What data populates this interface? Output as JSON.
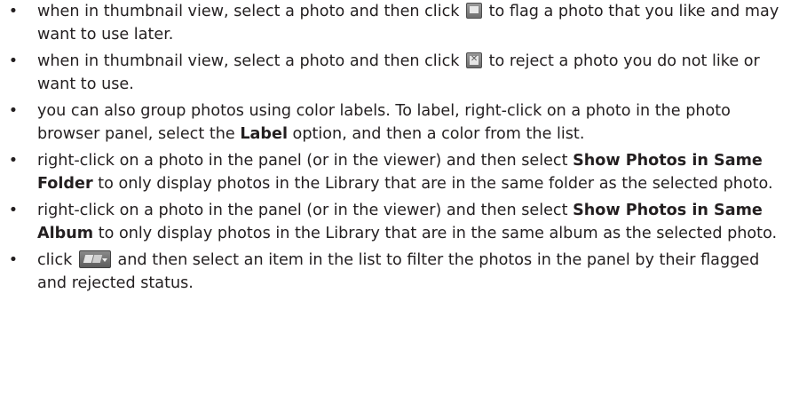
{
  "bullet_glyph": "•",
  "items": [
    {
      "before": "when in thumbnail view, select a photo and then click ",
      "icon": "flag-icon",
      "after": " to flag a photo that you like and may want to use later."
    },
    {
      "before": "when in thumbnail view, select a photo and then click ",
      "icon": "reject-icon",
      "after": " to reject a photo you do not like or want to use."
    },
    {
      "before": "you can also group photos using color labels. To label, right-click on a photo in the photo browser panel, select the ",
      "bold": "Label",
      "after": " option, and then a color from the list."
    },
    {
      "before": "right-click on a photo in the panel (or in the viewer) and then select ",
      "bold": "Show Photos in Same Folder",
      "after": " to only display photos in the Library that are in the same folder as the selected photo."
    },
    {
      "before": "right-click on a photo in the panel (or in the viewer) and then select ",
      "bold": "Show Photos in Same Album",
      "after": " to only display photos in the Library that are in the same album as the selected photo."
    },
    {
      "before": "click ",
      "icon": "flag-filter-dropdown-icon",
      "after": " and then select an item in the list to filter the photos in the panel by their flagged and rejected status."
    }
  ]
}
